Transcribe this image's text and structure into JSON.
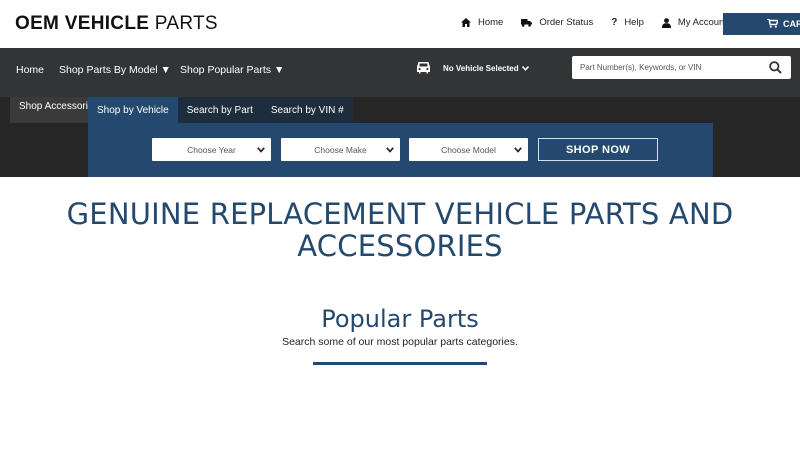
{
  "logo": {
    "brand_bold": "OEM VEHICLE",
    "brand_light": " PARTS"
  },
  "top_links": [
    {
      "label": "Home",
      "icon": "home-icon"
    },
    {
      "label": "Order Status",
      "icon": "truck-icon"
    },
    {
      "label": "Help",
      "icon": "question-icon"
    },
    {
      "label": "My Account",
      "icon": "user-icon"
    }
  ],
  "cart": {
    "label": "CART",
    "icon": "cart-icon"
  },
  "nav": {
    "home": "Home",
    "shop_by_model": "Shop Parts By Model ▼",
    "shop_popular": "Shop Popular Parts ▼",
    "vehicle_selected": "No Vehicle Selected",
    "search_placeholder": "Part Number(s), Keywords, or VIN"
  },
  "shop_accessories": "Shop Accessories",
  "finder": {
    "tabs": [
      {
        "label": "Shop by Vehicle",
        "active": true
      },
      {
        "label": "Search by Part",
        "active": false
      },
      {
        "label": "Search by VIN #",
        "active": false
      }
    ],
    "year_placeholder": "Choose Year",
    "make_placeholder": "Choose Make",
    "model_placeholder": "Choose Model",
    "shop_now": "SHOP NOW"
  },
  "main": {
    "headline_line1": "GENUINE REPLACEMENT VEHICLE PARTS AND",
    "headline_line2": "ACCESSORIES",
    "popular_title": "Popular Parts",
    "popular_subtitle": "Search some of our most popular parts categories."
  },
  "colors": {
    "accent": "#25496e",
    "nav_bg": "#333436",
    "band_bg": "#262626"
  }
}
